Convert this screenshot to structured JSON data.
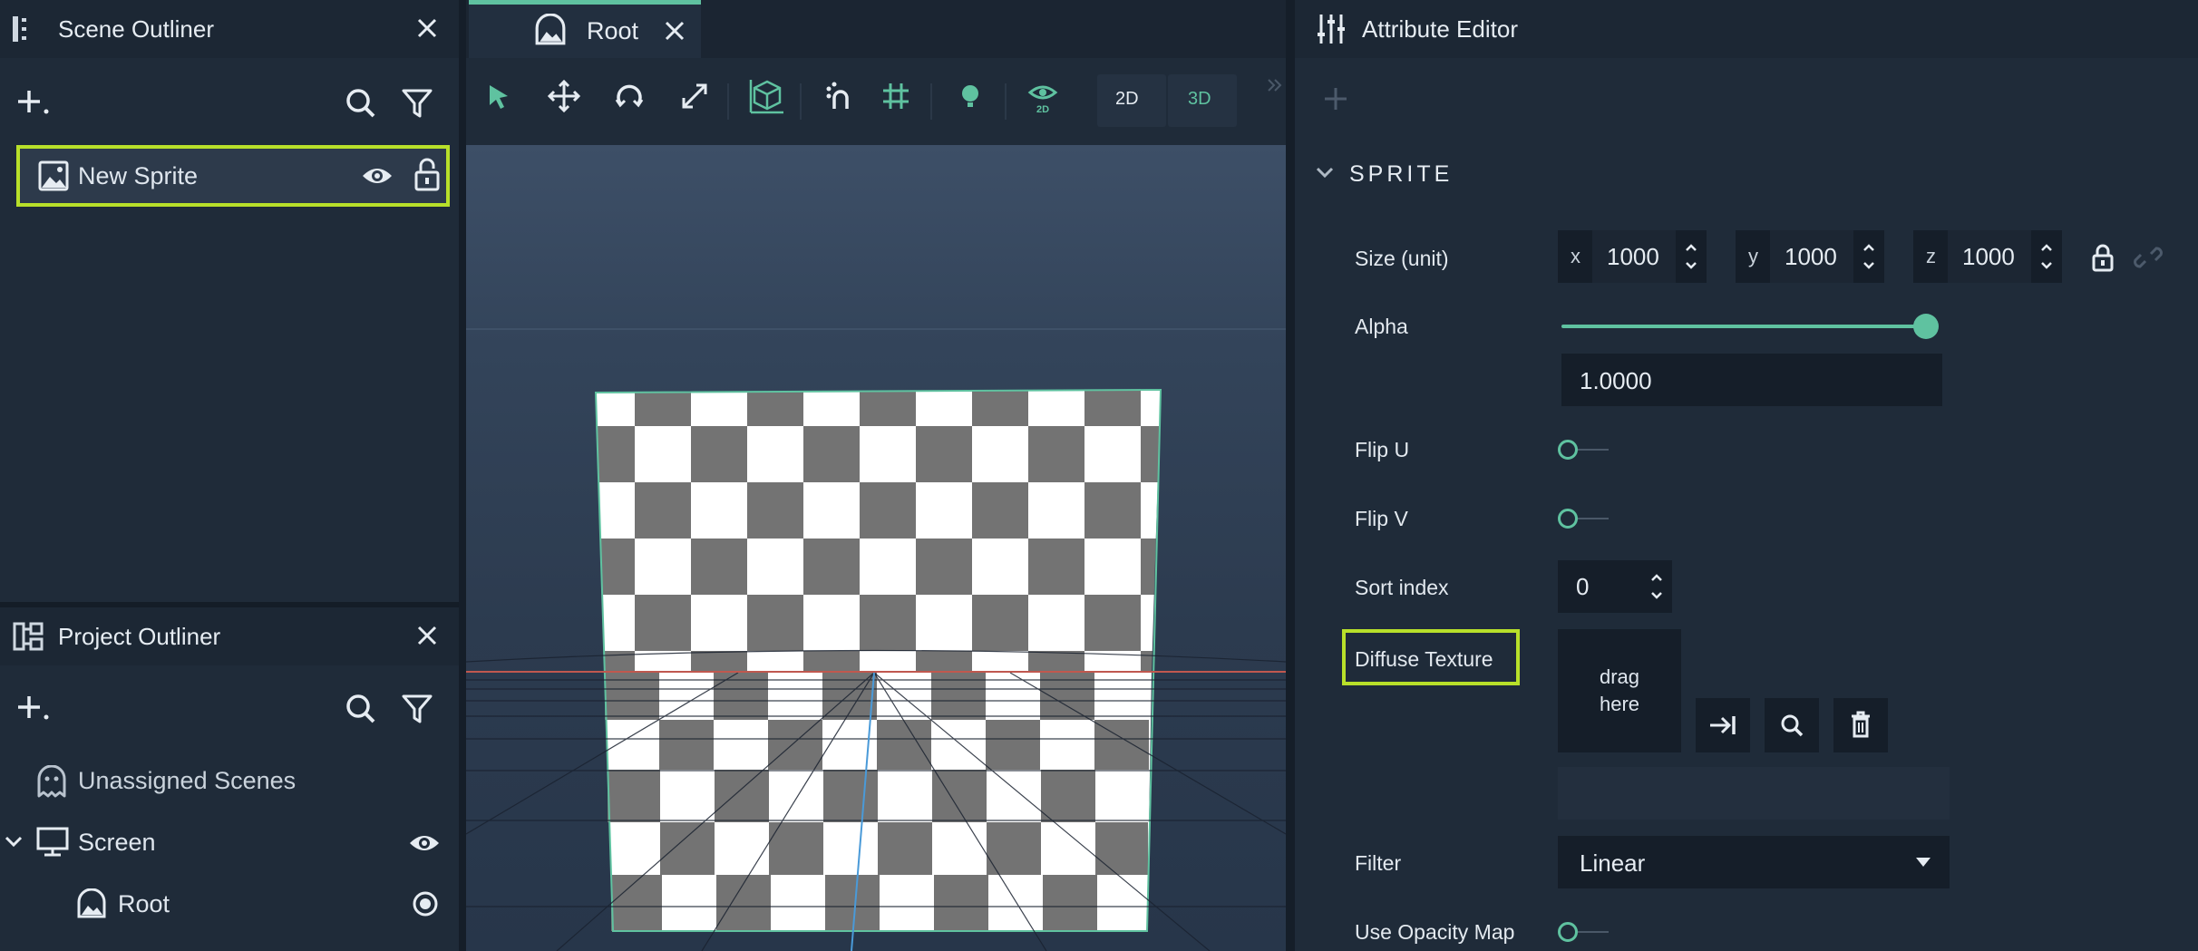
{
  "scene_outliner": {
    "title": "Scene Outliner",
    "items": [
      {
        "label": "New Sprite"
      }
    ]
  },
  "project_outliner": {
    "title": "Project Outliner",
    "items": [
      {
        "label": "Unassigned Scenes"
      },
      {
        "label": "Screen"
      },
      {
        "label": "Root"
      }
    ]
  },
  "viewport": {
    "tab_label": "Root",
    "toolbar": {
      "mode_2d": "2D",
      "mode_3d": "3D"
    }
  },
  "attribute_editor": {
    "title": "Attribute Editor",
    "section_title": "SPRITE",
    "size": {
      "label": "Size (unit)",
      "x_label": "x",
      "x_value": "1000",
      "y_label": "y",
      "y_value": "1000",
      "z_label": "z",
      "z_value": "1000"
    },
    "alpha": {
      "label": "Alpha",
      "value": "1.0000",
      "level": 1.0
    },
    "flip_u": {
      "label": "Flip U",
      "on": false
    },
    "flip_v": {
      "label": "Flip V",
      "on": false
    },
    "sort_index": {
      "label": "Sort index",
      "value": "0"
    },
    "diffuse_texture": {
      "label": "Diffuse Texture",
      "drop_line1": "drag",
      "drop_line2": "here"
    },
    "filter": {
      "label": "Filter",
      "value": "Linear"
    },
    "use_opacity_map": {
      "label": "Use Opacity Map",
      "on": false
    }
  },
  "colors": {
    "accent": "#5fc2a0",
    "highlight": "#b8e02a",
    "panel_bg": "#1f2b39",
    "field_bg": "#151e29"
  }
}
